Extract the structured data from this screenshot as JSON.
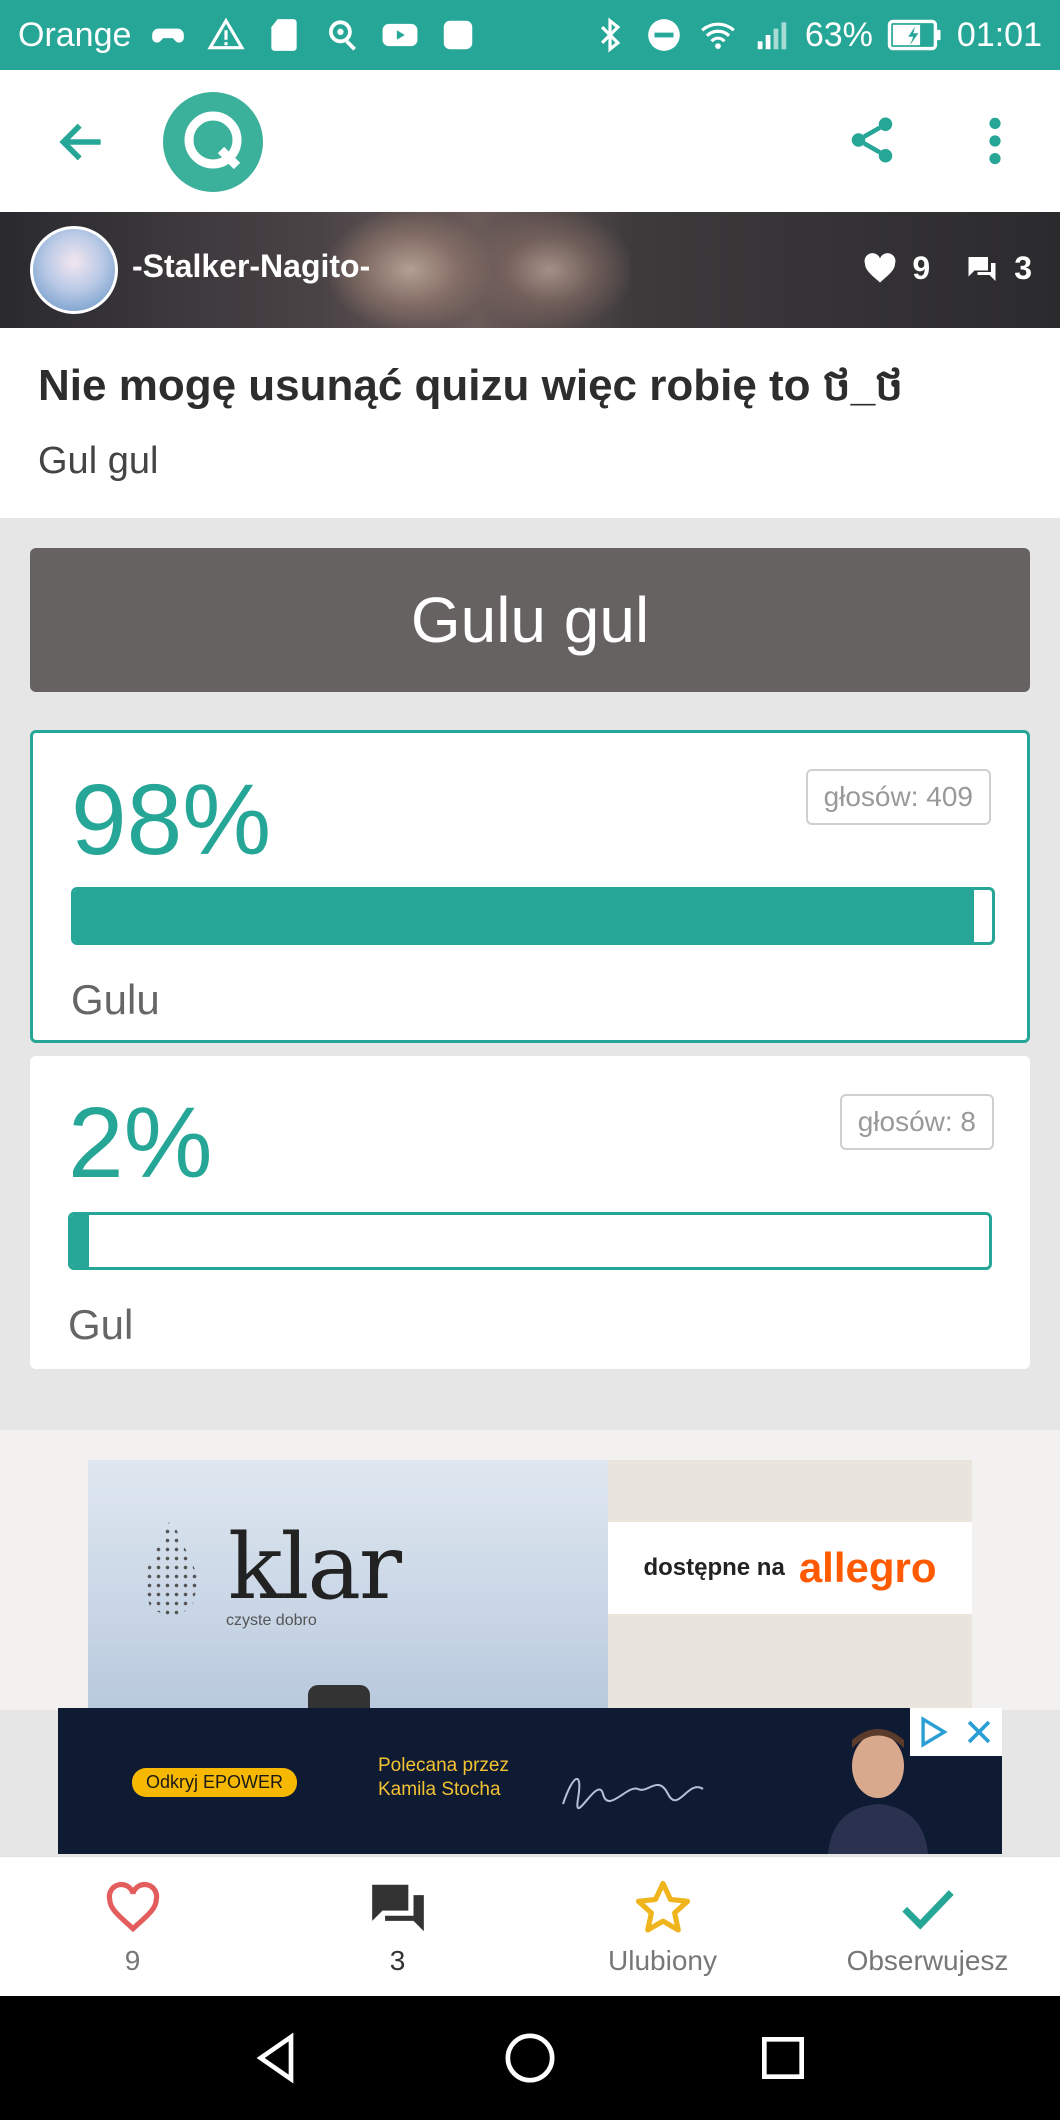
{
  "status_bar": {
    "carrier": "Orange",
    "battery": "63%",
    "time": "01:01"
  },
  "app_bar": {
    "logo_letter": "Q"
  },
  "author": {
    "name": "-Stalker-Nagito-",
    "likes": "9",
    "comments": "3"
  },
  "quiz": {
    "title": "Nie mogę usunąć quizu więc robię to ថ_ថ",
    "subtitle": "Gul gul",
    "question": "Gulu gul",
    "options": [
      {
        "percent_text": "98%",
        "percent": 98,
        "votes": "głosów: 409",
        "label": "Gulu",
        "selected": true
      },
      {
        "percent_text": "2%",
        "percent": 2,
        "votes": "głosów: 8",
        "label": "Gul",
        "selected": false
      }
    ]
  },
  "ads": {
    "klar": {
      "brand": "klar",
      "tagline": "czyste dobro",
      "available_text": "dostępne na",
      "store": "allegro"
    },
    "banner": {
      "button": "Odkryj EPOWER",
      "line1": "Polecana przez",
      "line2": "Kamila Stocha"
    }
  },
  "action_bar": {
    "likes_count": "9",
    "comments_count": "3",
    "favorite_label": "Ulubiony",
    "follow_label": "Obserwujesz"
  },
  "colors": {
    "accent": "#26a696",
    "question_bg": "#666262",
    "heart": "#e35d5d",
    "star": "#f0b51d"
  }
}
